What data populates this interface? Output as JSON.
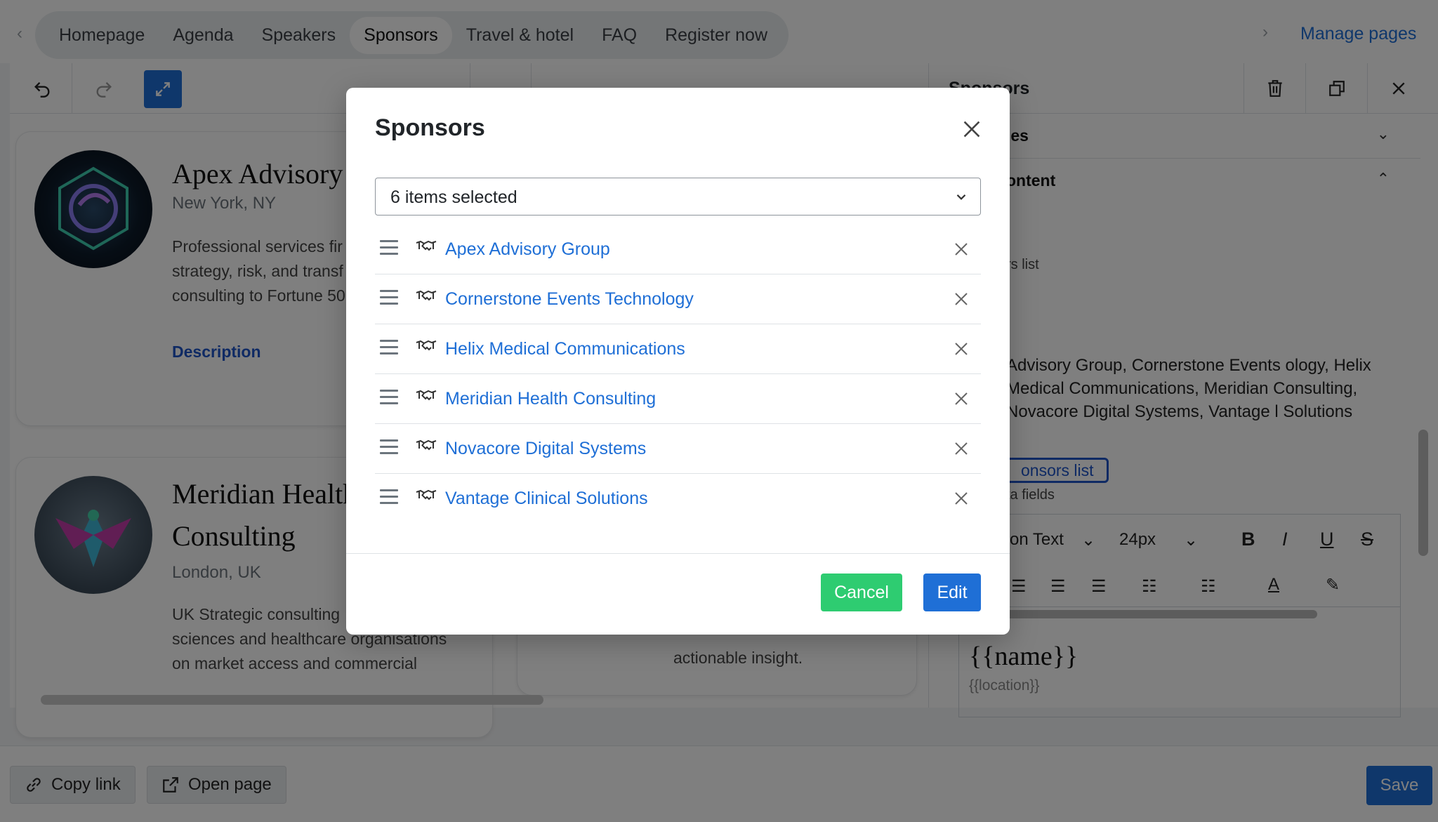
{
  "nav": {
    "tabs": [
      {
        "label": "Homepage"
      },
      {
        "label": "Agenda"
      },
      {
        "label": "Speakers"
      },
      {
        "label": "Sponsors",
        "active": true
      },
      {
        "label": "Travel & hotel"
      },
      {
        "label": "FAQ"
      },
      {
        "label": "Register now"
      }
    ],
    "manage_pages": "Manage pages"
  },
  "canvas": {
    "cards": [
      {
        "title": "Apex Advisory G",
        "location": "New York, NY",
        "desc_lines": [
          "Professional services fir",
          "strategy, risk, and transf",
          "consulting to Fortune 50"
        ],
        "link": "Description"
      },
      {
        "title_lines": [
          "Meridian Health",
          "Consulting"
        ],
        "location": "London, UK",
        "desc_lines": [
          "UK Strategic consulting",
          "sciences and healthcare organisations",
          "on market access and commercial"
        ]
      }
    ],
    "partial_text": "actionable insight."
  },
  "sidebar": {
    "title": "Sponsors",
    "sections": [
      {
        "label": "les",
        "expanded": false
      },
      {
        "label": "ontent",
        "expanded": true
      }
    ],
    "list_label": "rs list",
    "list_text": "Advisory Group, Cornerstone Events ology, Helix Medical Communications, Meridian Consulting, Novacore Digital Systems, Vantage l Solutions",
    "list_button": "onsors list",
    "fields_label": "ta fields",
    "editor": {
      "font": "son Text",
      "size": "24px",
      "name_token": "{{name}}",
      "location_token": "{{location}}"
    }
  },
  "footer": {
    "copy_link": "Copy link",
    "open_page": "Open page",
    "save": "Save"
  },
  "modal": {
    "title": "Sponsors",
    "select_value": "6 items selected",
    "items": [
      {
        "label": "Apex Advisory Group"
      },
      {
        "label": "Cornerstone Events Technology"
      },
      {
        "label": "Helix Medical Communications"
      },
      {
        "label": "Meridian Health Consulting"
      },
      {
        "label": "Novacore Digital Systems"
      },
      {
        "label": "Vantage Clinical Solutions"
      }
    ],
    "cancel": "Cancel",
    "edit": "Edit"
  },
  "colors": {
    "primary": "#1f6fd6",
    "success": "#2ecc71",
    "link": "#1f6fd6"
  }
}
